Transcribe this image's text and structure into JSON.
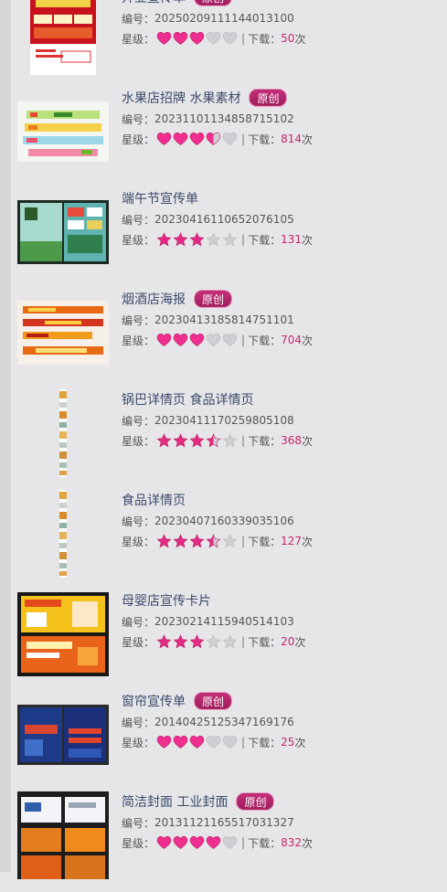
{
  "colors": {
    "accent": "#c7266e",
    "badge": "#b42569",
    "title": "#3b4a6b",
    "heart": "#ef2f8f",
    "star": "#e42a83"
  },
  "labels": {
    "code_prefix": "编号：",
    "rating_prefix": "星级：",
    "download_prefix": "下载：",
    "times_suffix": "次",
    "separator": "|"
  },
  "items": [
    {
      "title": "开业宣传单",
      "badge": "原创",
      "code": "20250209111144013100",
      "rating_icon": "heart",
      "rating": 3,
      "downloads": "50",
      "thumb": "opening-flyer"
    },
    {
      "title": "水果店招牌 水果素材",
      "badge": "原创",
      "code": "20231101134858715102",
      "rating_icon": "heart",
      "rating": 3.5,
      "downloads": "814",
      "thumb": "fruit-signboard"
    },
    {
      "title": "端午节宣传单",
      "badge": "",
      "code": "20230416110652076105",
      "rating_icon": "star",
      "rating": 3,
      "downloads": "131",
      "thumb": "dragon-boat-flyer"
    },
    {
      "title": "烟酒店海报",
      "badge": "原创",
      "code": "20230413185814751101",
      "rating_icon": "heart",
      "rating": 3,
      "downloads": "704",
      "thumb": "tobacco-banner"
    },
    {
      "title": "锅巴详情页 食品详情页",
      "badge": "",
      "code": "20230411170259805108",
      "rating_icon": "star",
      "rating": 3.5,
      "downloads": "368",
      "thumb": "long-detail-page"
    },
    {
      "title": "食品详情页",
      "badge": "",
      "code": "20230407160339035106",
      "rating_icon": "star",
      "rating": 3.5,
      "downloads": "127",
      "thumb": "long-detail-page"
    },
    {
      "title": "母婴店宣传卡片",
      "badge": "",
      "code": "20230214115940514103",
      "rating_icon": "star",
      "rating": 3,
      "downloads": "20",
      "thumb": "baby-store-card"
    },
    {
      "title": "窗帘宣传单",
      "badge": "原创",
      "code": "20140425125347169176",
      "rating_icon": "heart",
      "rating": 3,
      "downloads": "25",
      "thumb": "curtain-flyer"
    },
    {
      "title": "简洁封面 工业封面",
      "badge": "原创",
      "code": "20131121165517031327",
      "rating_icon": "heart",
      "rating": 4,
      "downloads": "832",
      "thumb": "industrial-cover"
    }
  ]
}
